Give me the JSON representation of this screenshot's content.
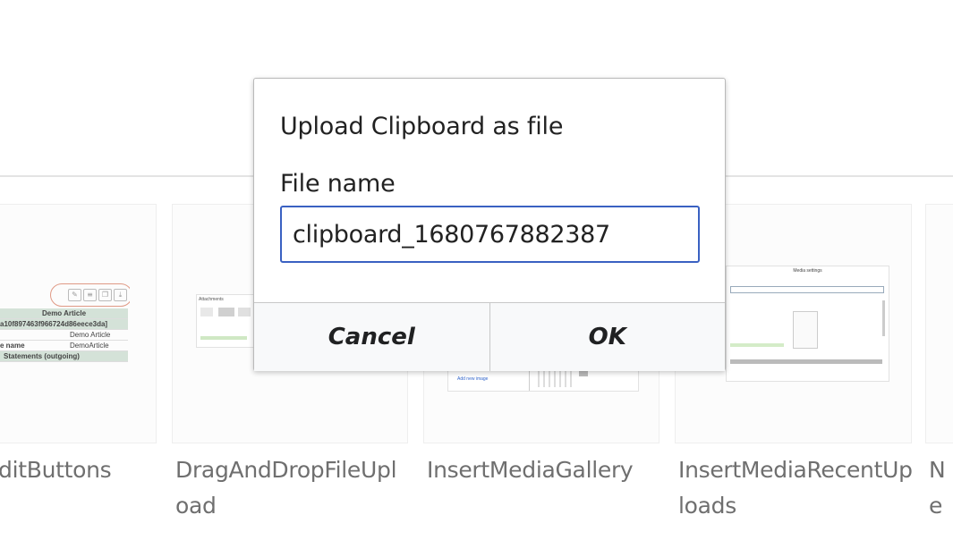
{
  "dialog": {
    "title": "Upload Clipboard as file",
    "field_label": "File name",
    "field_value": "clipboard_1680767882387",
    "cancel_label": "Cancel",
    "ok_label": "OK"
  },
  "gallery": {
    "cards": [
      {
        "caption": "EditButtons",
        "visible_caption": "ditButtons"
      },
      {
        "caption": "DragAndDropFileUpload"
      },
      {
        "caption": "InsertMediaGallery"
      },
      {
        "caption": "InsertMediaRecentUploads"
      },
      {
        "caption": "Ne"
      }
    ],
    "thumb1": {
      "table_title": "Demo Article",
      "table_id": "a10f897463f966724d86eece3da]",
      "row1_value": "Demo Article",
      "row2_label": "e name",
      "row2_value": "DemoArticle",
      "row3_label": "Statements (outgoing)"
    },
    "thumb2": {
      "heading": "Attachments"
    },
    "thumb3": {
      "add_label": "Add new image"
    },
    "thumb4": {
      "title": "Media settings"
    }
  },
  "colors": {
    "input_focus_border": "#3a61c2",
    "caption_text": "#6f6f6f",
    "dialog_footer_bg": "#f8f9fa"
  }
}
